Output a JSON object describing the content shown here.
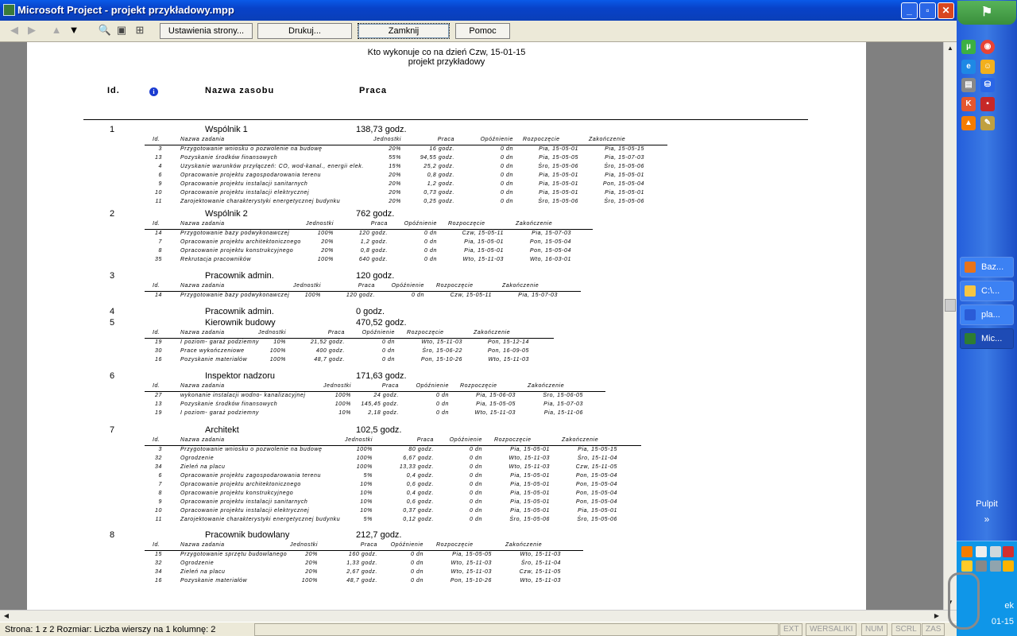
{
  "window": {
    "title": "Microsoft Project - projekt przykładowy.mpp"
  },
  "toolbar": {
    "page_setup": "Ustawienia strony...",
    "print": "Drukuj...",
    "close": "Zamknij",
    "help": "Pomoc"
  },
  "report": {
    "title": "Kto wykonuje co na dzień Czw, 15-01-15",
    "subtitle": "projekt przykładowy",
    "columns": {
      "id": "Id.",
      "info": "i",
      "name": "Nazwa zasobu",
      "work": "Praca"
    },
    "task_columns": {
      "id": "Id.",
      "name": "Nazwa zadania",
      "units": "Jednostki",
      "work": "Praca",
      "delay": "Opóźnienie",
      "start": "Rozpoczęcie",
      "finish": "Zakończenie"
    },
    "resources": [
      {
        "id": "1",
        "name": "Wspólnik 1",
        "work": "138,73 godz.",
        "tasks": [
          {
            "id": "3",
            "name": "Przygotowanie wniosku o pozwolenie na budowę",
            "units": "20%",
            "work": "16 godz.",
            "delay": "0 dn",
            "start": "Pia, 15-05-01",
            "finish": "Pia, 15-05-15"
          },
          {
            "id": "13",
            "name": "Pozyskanie środków finansowych",
            "units": "55%",
            "work": "94,55 godz.",
            "delay": "0 dn",
            "start": "Pia, 15-05-05",
            "finish": "Pia, 15-07-03"
          },
          {
            "id": "4",
            "name": "Uzyskanie warunków przyłączeń: CO, wod-kanal., energii elek.",
            "units": "15%",
            "work": "25,2 godz.",
            "delay": "0 dn",
            "start": "Śro, 15-05-06",
            "finish": "Śro, 15-05-06"
          },
          {
            "id": "6",
            "name": "Opracowanie projektu zagospodarowania terenu",
            "units": "20%",
            "work": "0,8 godz.",
            "delay": "0 dn",
            "start": "Pia, 15-05-01",
            "finish": "Pia, 15-05-01"
          },
          {
            "id": "9",
            "name": "Opracowanie projektu instalacji sanitarnych",
            "units": "20%",
            "work": "1,2 godz.",
            "delay": "0 dn",
            "start": "Pia, 15-05-01",
            "finish": "Pon, 15-05-04"
          },
          {
            "id": "10",
            "name": "Opracowanie projektu instalacji elektrycznej",
            "units": "20%",
            "work": "0,73 godz.",
            "delay": "0 dn",
            "start": "Pia, 15-05-01",
            "finish": "Pia, 15-05-01"
          },
          {
            "id": "11",
            "name": "Zarojektowanie charakterystyki energetycznej budynku",
            "units": "20%",
            "work": "0,25 godz.",
            "delay": "0 dn",
            "start": "Śro, 15-05-06",
            "finish": "Śro, 15-05-06"
          }
        ]
      },
      {
        "id": "2",
        "name": "Wspólnik 2",
        "work": "762 godz.",
        "tasks": [
          {
            "id": "14",
            "name": "Przygotowanie bazy podwykonawczej",
            "units": "100%",
            "work": "120 godz.",
            "delay": "0 dn",
            "start": "Czw, 15-05-11",
            "finish": "Pia, 15-07-03"
          },
          {
            "id": "7",
            "name": "Opracowanie projektu architektonicznego",
            "units": "20%",
            "work": "1,2 godz.",
            "delay": "0 dn",
            "start": "Pia, 15-05-01",
            "finish": "Pon, 15-05-04"
          },
          {
            "id": "8",
            "name": "Opracowanie projektu konstrukcyjnego",
            "units": "20%",
            "work": "0,8 godz.",
            "delay": "0 dn",
            "start": "Pia, 15-05-01",
            "finish": "Pon, 15-05-04"
          },
          {
            "id": "35",
            "name": "Rekrutacja pracowników",
            "units": "100%",
            "work": "640 godz.",
            "delay": "0 dn",
            "start": "Wto, 15-11-03",
            "finish": "Wto, 16-03-01"
          }
        ]
      },
      {
        "id": "3",
        "name": "Pracownik admin.",
        "work": "120 godz.",
        "tasks": [
          {
            "id": "14",
            "name": "Przygotowanie bazy podwykonawczej",
            "units": "100%",
            "work": "120 godz.",
            "delay": "0 dn",
            "start": "Czw, 15-05-11",
            "finish": "Pia, 15-07-03"
          }
        ]
      },
      {
        "id": "4",
        "name": "Pracownik admin.",
        "work": "0 godz.",
        "tasks": []
      },
      {
        "id": "5",
        "name": "Kierownik budowy",
        "work": "470,52 godz.",
        "tasks": [
          {
            "id": "19",
            "name": "I poziom- garaż podziemny",
            "units": "10%",
            "work": "21,52 godz.",
            "delay": "0 dn",
            "start": "Wto, 15-11-03",
            "finish": "Pon, 15-12-14"
          },
          {
            "id": "30",
            "name": "Prace wykończeniowe",
            "units": "100%",
            "work": "400 godz.",
            "delay": "0 dn",
            "start": "Śro, 15-06-22",
            "finish": "Pon, 16-09-05"
          },
          {
            "id": "16",
            "name": "Pozyskanie materiałów",
            "units": "100%",
            "work": "48,7 godz.",
            "delay": "0 dn",
            "start": "Pon, 15-10-26",
            "finish": "Wto, 15-11-03"
          }
        ]
      },
      {
        "id": "6",
        "name": "Inspektor nadzoru",
        "work": "171,63 godz.",
        "tasks": [
          {
            "id": "27",
            "name": "wykonanie instalacji wodno- kanalizacyjnej",
            "units": "100%",
            "work": "24 godz.",
            "delay": "0 dn",
            "start": "Pia, 15-06-03",
            "finish": "Śro, 15-06-05"
          },
          {
            "id": "13",
            "name": "Pozyskanie środków finansowych",
            "units": "100%",
            "work": "145,45 godz.",
            "delay": "0 dn",
            "start": "Pia, 15-05-05",
            "finish": "Pia, 15-07-03"
          },
          {
            "id": "19",
            "name": "I poziom- garaż podziemny",
            "units": "10%",
            "work": "2,18 godz.",
            "delay": "0 dn",
            "start": "Wto, 15-11-03",
            "finish": "Pia, 15-11-06"
          }
        ]
      },
      {
        "id": "7",
        "name": "Architekt",
        "work": "102,5 godz.",
        "tasks": [
          {
            "id": "3",
            "name": "Przygotowanie wniosku o pozwolenie na budowę",
            "units": "100%",
            "work": "80 godz.",
            "delay": "0 dn",
            "start": "Pia, 15-05-01",
            "finish": "Pia, 15-05-15"
          },
          {
            "id": "32",
            "name": "Ogrodzenie",
            "units": "100%",
            "work": "6,67 godz.",
            "delay": "0 dn",
            "start": "Wto, 15-11-03",
            "finish": "Śro, 15-11-04"
          },
          {
            "id": "34",
            "name": "Zieleń na placu",
            "units": "100%",
            "work": "13,33 godz.",
            "delay": "0 dn",
            "start": "Wto, 15-11-03",
            "finish": "Czw, 15-11-05"
          },
          {
            "id": "6",
            "name": "Opracowanie projektu zagospodarowania terenu",
            "units": "5%",
            "work": "0,4 godz.",
            "delay": "0 dn",
            "start": "Pia, 15-05-01",
            "finish": "Pon, 15-05-04"
          },
          {
            "id": "7",
            "name": "Opracowanie projektu architektonicznego",
            "units": "10%",
            "work": "0,6 godz.",
            "delay": "0 dn",
            "start": "Pia, 15-05-01",
            "finish": "Pon, 15-05-04"
          },
          {
            "id": "8",
            "name": "Opracowanie projektu konstrukcyjnego",
            "units": "10%",
            "work": "0,4 godz.",
            "delay": "0 dn",
            "start": "Pia, 15-05-01",
            "finish": "Pon, 15-05-04"
          },
          {
            "id": "9",
            "name": "Opracowanie projektu instalacji sanitarnych",
            "units": "10%",
            "work": "0,6 godz.",
            "delay": "0 dn",
            "start": "Pia, 15-05-01",
            "finish": "Pon, 15-05-04"
          },
          {
            "id": "10",
            "name": "Opracowanie projektu instalacji elektrycznej",
            "units": "10%",
            "work": "0,37 godz.",
            "delay": "0 dn",
            "start": "Pia, 15-05-01",
            "finish": "Pia, 15-05-01"
          },
          {
            "id": "11",
            "name": "Zarojektowanie charakterystyki energetycznej budynku",
            "units": "5%",
            "work": "0,12 godz.",
            "delay": "0 dn",
            "start": "Śro, 15-05-06",
            "finish": "Śro, 15-05-06"
          }
        ]
      },
      {
        "id": "8",
        "name": "Pracownik budowlany",
        "work": "212,7 godz.",
        "tasks": [
          {
            "id": "15",
            "name": "Przygotowanie sprzętu budowlanego",
            "units": "20%",
            "work": "160 godz.",
            "delay": "0 dn",
            "start": "Pia, 15-05-05",
            "finish": "Wto, 15-11-03"
          },
          {
            "id": "32",
            "name": "Ogrodzenie",
            "units": "20%",
            "work": "1,33 godz.",
            "delay": "0 dn",
            "start": "Wto, 15-11-03",
            "finish": "Śro, 15-11-04"
          },
          {
            "id": "34",
            "name": "Zieleń na placu",
            "units": "20%",
            "work": "2,67 godz.",
            "delay": "0 dn",
            "start": "Wto, 15-11-03",
            "finish": "Czw, 15-11-05"
          },
          {
            "id": "16",
            "name": "Pozyskanie materiałów",
            "units": "100%",
            "work": "48,7 godz.",
            "delay": "0 dn",
            "start": "Pon, 15-10-26",
            "finish": "Wto, 15-11-03"
          }
        ]
      }
    ]
  },
  "statusbar": {
    "text": "Strona: 1 z 2   Rozmiar: Liczba wierszy na 1 kolumnę: 2",
    "indicators": [
      "EXT",
      "WERSALIKI",
      "NUM",
      "SCRL",
      "ZAS"
    ]
  },
  "taskbar": {
    "items": [
      {
        "label": "Baz...",
        "color": "#e8731a"
      },
      {
        "label": "C:\\...",
        "color": "#f5c542"
      },
      {
        "label": "pla...",
        "color": "#2a5bd7"
      },
      {
        "label": "Mic...",
        "color": "#2e7d32"
      }
    ],
    "desktop_label": "Pulpit",
    "clock_line1": "ek",
    "clock_line2": "01-15"
  }
}
